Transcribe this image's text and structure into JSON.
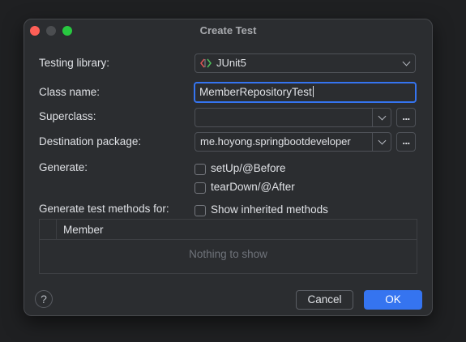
{
  "dialog": {
    "title": "Create Test"
  },
  "form": {
    "testing_library_label": "Testing library:",
    "testing_library_value": "JUnit5",
    "testing_library_icon": "junit-icon",
    "class_name_label": "Class name:",
    "class_name_value": "MemberRepositoryTest",
    "superclass_label": "Superclass:",
    "superclass_value": "",
    "browse_label": "...",
    "destination_package_label": "Destination package:",
    "destination_package_value": "me.hoyong.springbootdeveloper",
    "generate_label": "Generate:",
    "generate_options": [
      {
        "label": "setUp/@Before",
        "checked": false
      },
      {
        "label": "tearDown/@After",
        "checked": false
      }
    ],
    "generate_methods_label": "Generate test methods for:",
    "show_inherited_label": "Show inherited methods",
    "show_inherited_checked": false
  },
  "members_table": {
    "column_header": "Member",
    "empty_text": "Nothing to show"
  },
  "footer": {
    "help_label": "?",
    "cancel_label": "Cancel",
    "ok_label": "OK"
  },
  "colors": {
    "accent": "#3574f0",
    "background": "#2b2d30",
    "close": "#fe5f57",
    "maximize": "#28c840"
  }
}
